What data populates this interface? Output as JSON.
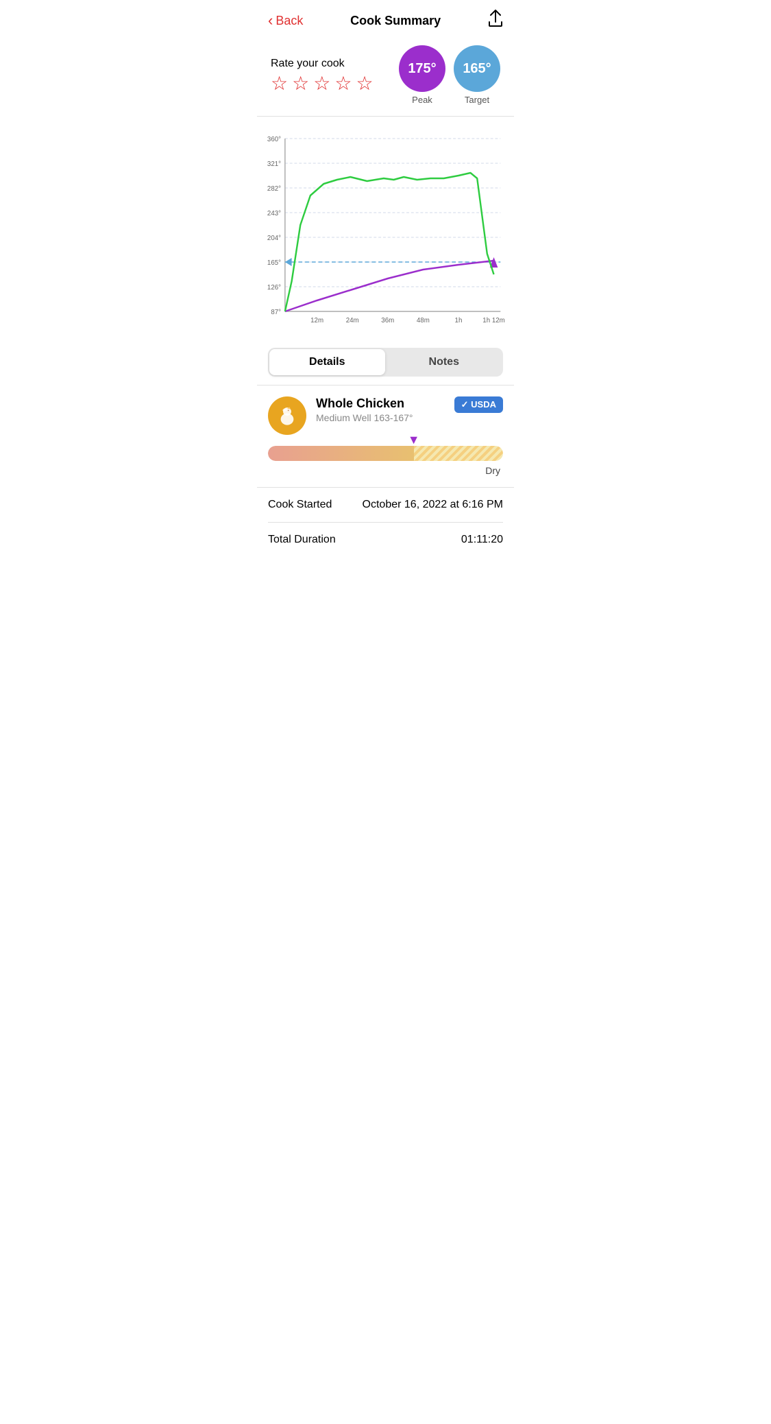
{
  "header": {
    "back_label": "Back",
    "title": "Cook Summary",
    "share_icon": "↑"
  },
  "rating": {
    "label": "Rate your cook",
    "stars": [
      "☆",
      "☆",
      "☆",
      "☆",
      "☆"
    ],
    "peak": {
      "value": "175°",
      "label": "Peak"
    },
    "target": {
      "value": "165°",
      "label": "Target"
    }
  },
  "chart": {
    "y_labels": [
      "360°",
      "321°",
      "282°",
      "243°",
      "204°",
      "165°",
      "126°",
      "87°"
    ],
    "x_labels": [
      "12m",
      "24m",
      "36m",
      "48m",
      "1h",
      "1h 12m"
    ]
  },
  "tabs": [
    {
      "id": "details",
      "label": "Details",
      "active": true
    },
    {
      "id": "notes",
      "label": "Notes",
      "active": false
    }
  ],
  "food": {
    "name": "Whole Chicken",
    "doneness_name": "Medium Well",
    "doneness_range": "163-167°",
    "usda_label": "✓ USDA",
    "doneness_end_label": "Dry"
  },
  "stats": [
    {
      "label": "Cook Started",
      "value": "October 16, 2022 at 6:16 PM"
    },
    {
      "label": "Total Duration",
      "value": "01:11:20"
    }
  ]
}
